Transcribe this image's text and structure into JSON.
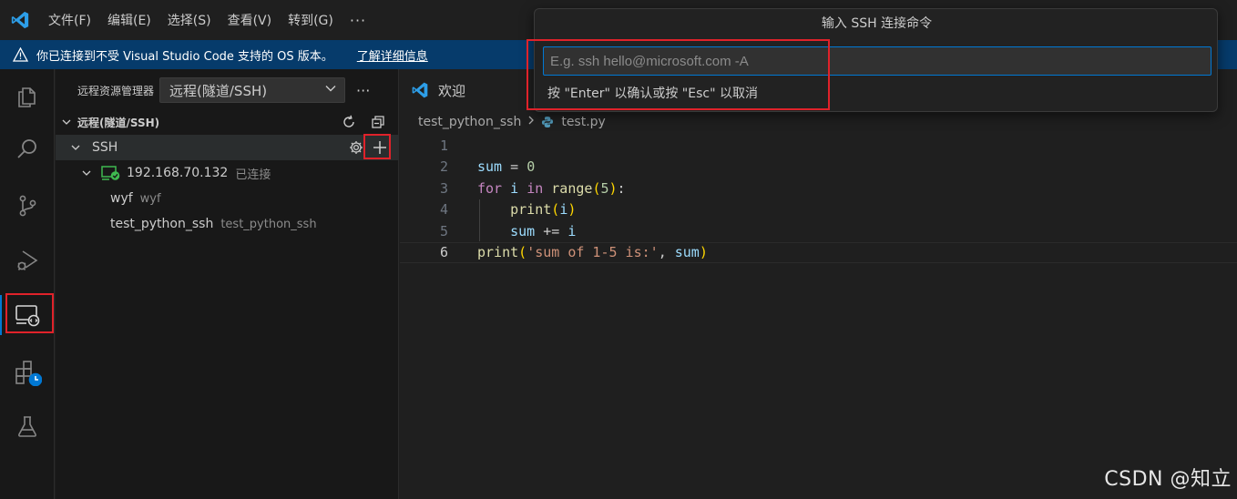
{
  "menu": {
    "items": [
      "文件(F)",
      "编辑(E)",
      "选择(S)",
      "查看(V)",
      "转到(G)"
    ],
    "more": "···"
  },
  "banner": {
    "message": "你已连接到不受 Visual Studio Code 支持的 OS 版本。",
    "link": "了解详细信息"
  },
  "activity_bar": {
    "items": [
      "explorer-icon",
      "search-icon",
      "source-control-icon",
      "run-debug-icon",
      "remote-explorer-icon",
      "extensions-icon",
      "testing-icon"
    ],
    "active": "remote-explorer-icon"
  },
  "sidebar": {
    "title": "远程资源管理器",
    "select_value": "远程(隧道/SSH)",
    "more": "···",
    "section": "远程(隧道/SSH)",
    "ssh_label": "SSH",
    "host": {
      "name": "192.168.70.132",
      "status": "已连接"
    },
    "folders": [
      {
        "name": "wyf",
        "path": "wyf"
      },
      {
        "name": "test_python_ssh",
        "path": "test_python_ssh"
      }
    ]
  },
  "editor": {
    "tab_label": "欢迎",
    "breadcrumb": {
      "folder": "test_python_ssh",
      "file": "test.py"
    },
    "current_line": 6,
    "lines": [
      {
        "n": "1"
      },
      {
        "n": "2"
      },
      {
        "n": "3"
      },
      {
        "n": "4"
      },
      {
        "n": "5"
      },
      {
        "n": "6"
      }
    ]
  },
  "quick_input": {
    "title": "输入 SSH 连接命令",
    "placeholder": "E.g. ssh hello@microsoft.com -A",
    "value": "",
    "message": "按 \"Enter\" 以确认或按 \"Esc\" 以取消"
  },
  "watermark": "CSDN @知立",
  "colors": {
    "accent": "#0078d4",
    "highlight_box": "#e0222a",
    "banner_bg": "#063b6b",
    "connected": "#3fb950"
  }
}
